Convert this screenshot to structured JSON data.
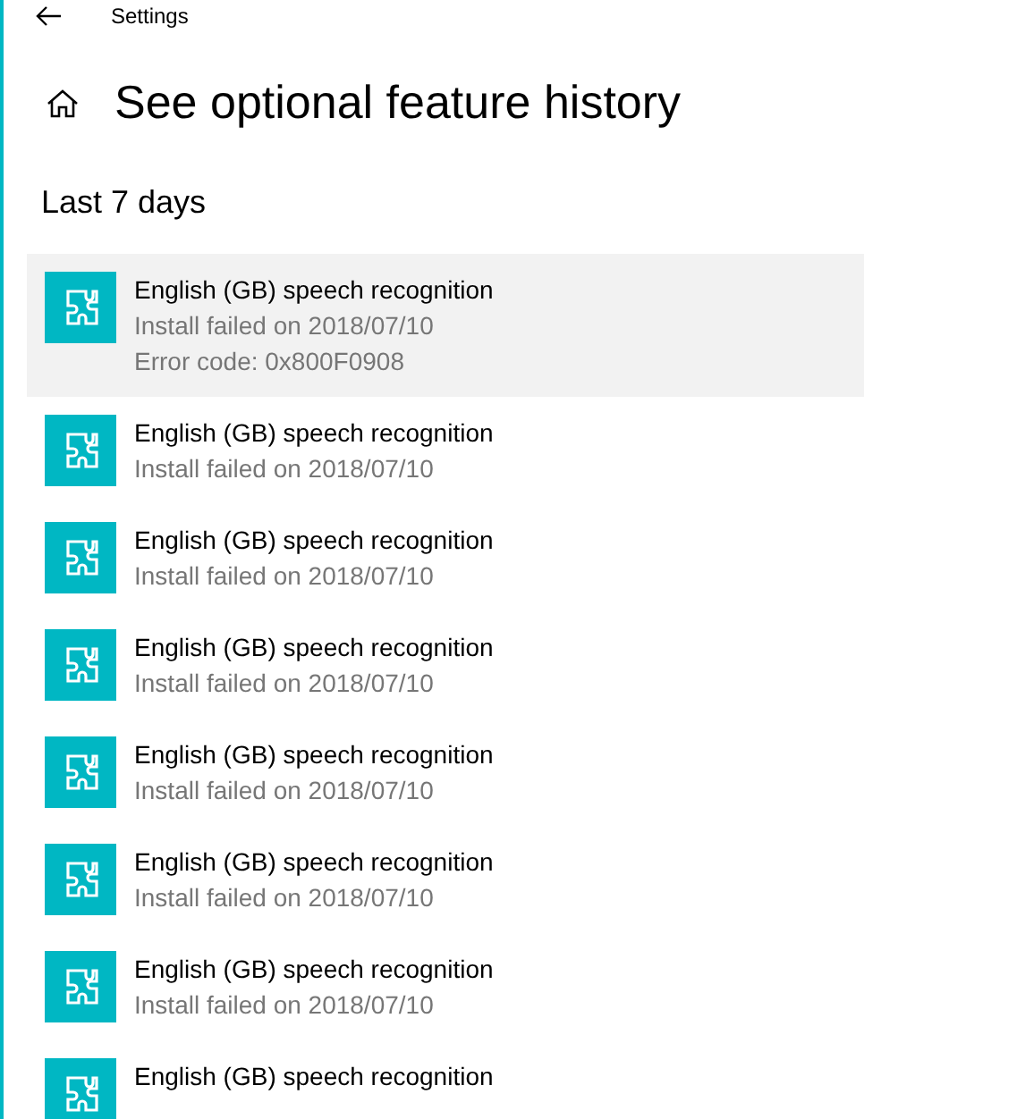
{
  "window": {
    "title": "Settings"
  },
  "page": {
    "title": "See optional feature history"
  },
  "section": {
    "title": "Last 7 days"
  },
  "items": [
    {
      "name": "English (GB) speech recognition",
      "status": "Install failed on 2018/07/10",
      "error": "Error code: 0x800F0908",
      "selected": true
    },
    {
      "name": "English (GB) speech recognition",
      "status": "Install failed on 2018/07/10",
      "selected": false
    },
    {
      "name": "English (GB) speech recognition",
      "status": "Install failed on 2018/07/10",
      "selected": false
    },
    {
      "name": "English (GB) speech recognition",
      "status": "Install failed on 2018/07/10",
      "selected": false
    },
    {
      "name": "English (GB) speech recognition",
      "status": "Install failed on 2018/07/10",
      "selected": false
    },
    {
      "name": "English (GB) speech recognition",
      "status": "Install failed on 2018/07/10",
      "selected": false
    },
    {
      "name": "English (GB) speech recognition",
      "status": "Install failed on 2018/07/10",
      "selected": false
    },
    {
      "name": "English (GB) speech recognition",
      "selected": false
    }
  ]
}
